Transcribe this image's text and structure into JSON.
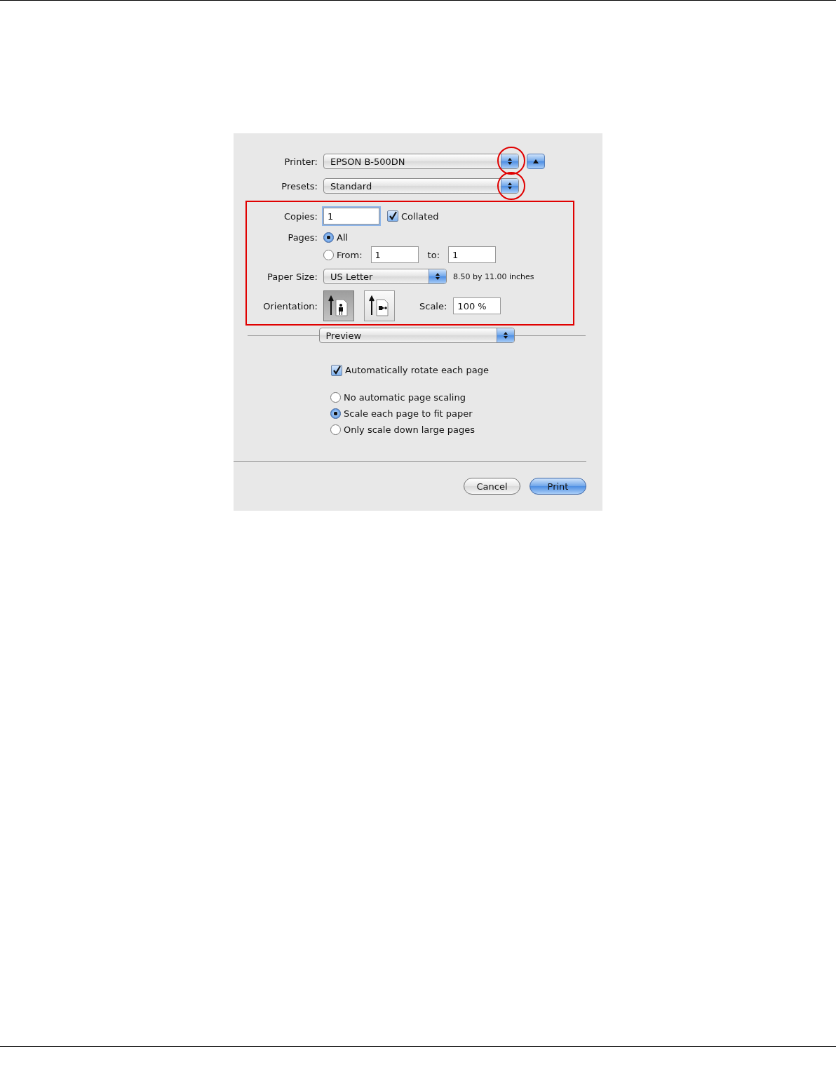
{
  "printer": {
    "label": "Printer:",
    "value": "EPSON B-500DN"
  },
  "presets": {
    "label": "Presets:",
    "value": "Standard"
  },
  "copies": {
    "label": "Copies:",
    "value": "1"
  },
  "collated": {
    "label": "Collated",
    "checked": true
  },
  "pages": {
    "label": "Pages:",
    "options": [
      {
        "label": "All",
        "selected": true
      },
      {
        "label": "From:",
        "selected": false
      }
    ],
    "from": "1",
    "to_label": "to:",
    "to": "1"
  },
  "paper_size": {
    "label": "Paper Size:",
    "value": "US Letter",
    "dimensions": "8.50 by 11.00 inches"
  },
  "orientation": {
    "label": "Orientation:",
    "options": [
      {
        "kind": "portrait",
        "selected": true
      },
      {
        "kind": "landscape",
        "selected": false
      }
    ]
  },
  "scale": {
    "label": "Scale:",
    "value": "100 %"
  },
  "panel": {
    "value": "Preview"
  },
  "auto_rotate": {
    "label": "Automatically rotate each page",
    "checked": true
  },
  "scaling": [
    {
      "label": "No automatic page scaling",
      "selected": false
    },
    {
      "label": "Scale each page to fit paper",
      "selected": true
    },
    {
      "label": "Only scale down large pages",
      "selected": false
    }
  ],
  "buttons": [
    {
      "label": "Cancel",
      "kind": "secondary"
    },
    {
      "label": "Print",
      "kind": "default"
    }
  ]
}
